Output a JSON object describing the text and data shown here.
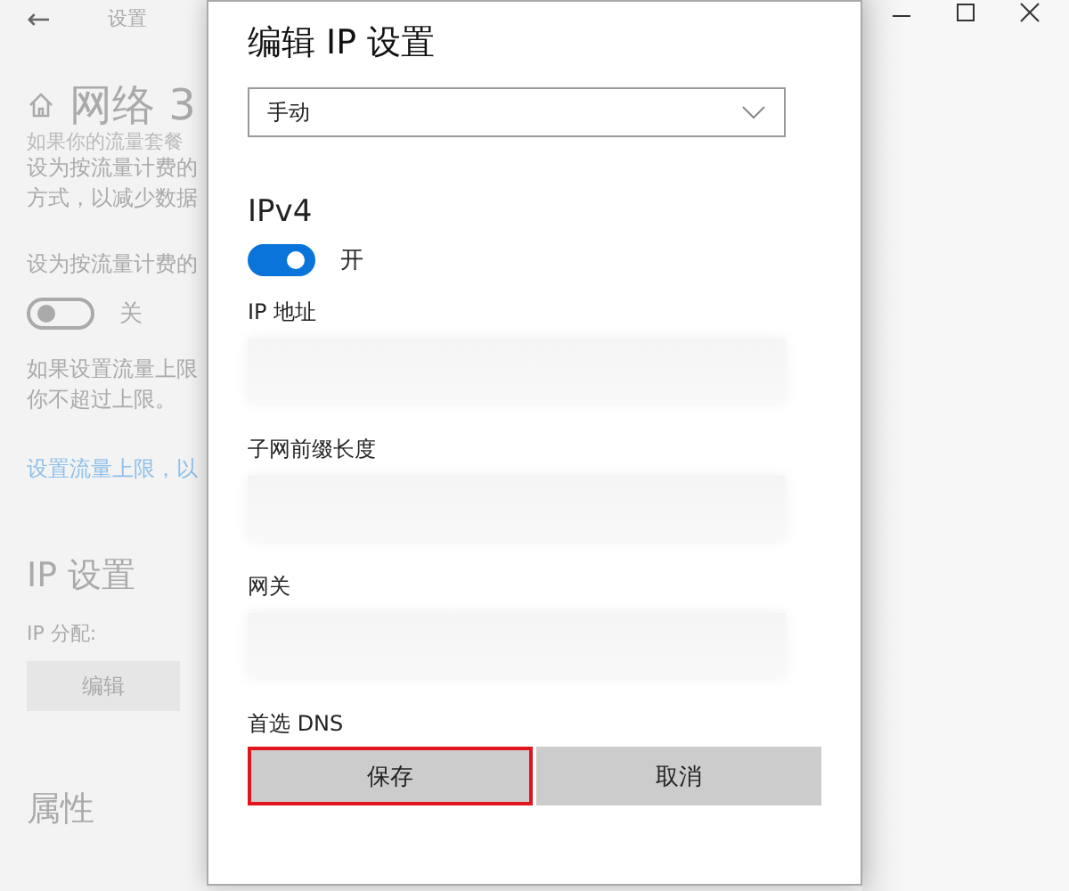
{
  "background_page": {
    "header": {
      "back_label": "←",
      "title": "设置"
    },
    "page_title": "网络 3",
    "texts": [
      {
        "kind": "cut",
        "text": "如果你的流量套餐"
      },
      {
        "kind": "para",
        "text": "设为按流量计费的"
      },
      {
        "kind": "para",
        "text": "方式，以减少数据"
      },
      {
        "kind": "gap",
        "text": "设为按流量计费的"
      }
    ],
    "metered_toggle": {
      "on": false,
      "label": "关"
    },
    "limit_texts": [
      "如果设置流量上限",
      "你不超过上限。"
    ],
    "limit_link": "设置流量上限，以",
    "ip_section": {
      "title": "IP 设置",
      "label": "IP 分配:",
      "button": "编辑"
    },
    "properties_title": "属性"
  },
  "dialog": {
    "title": "编辑 IP 设置",
    "mode": "手动",
    "section": "IPv4",
    "ipv4_toggle": {
      "on": true,
      "label": "开"
    },
    "fields": [
      {
        "label": "IP 地址"
      },
      {
        "label": "子网前缀长度"
      },
      {
        "label": "网关"
      },
      {
        "label": "首选 DNS"
      }
    ],
    "buttons": [
      {
        "label": "保存",
        "highlighted": true
      },
      {
        "label": "取消",
        "highlighted": false
      }
    ]
  }
}
